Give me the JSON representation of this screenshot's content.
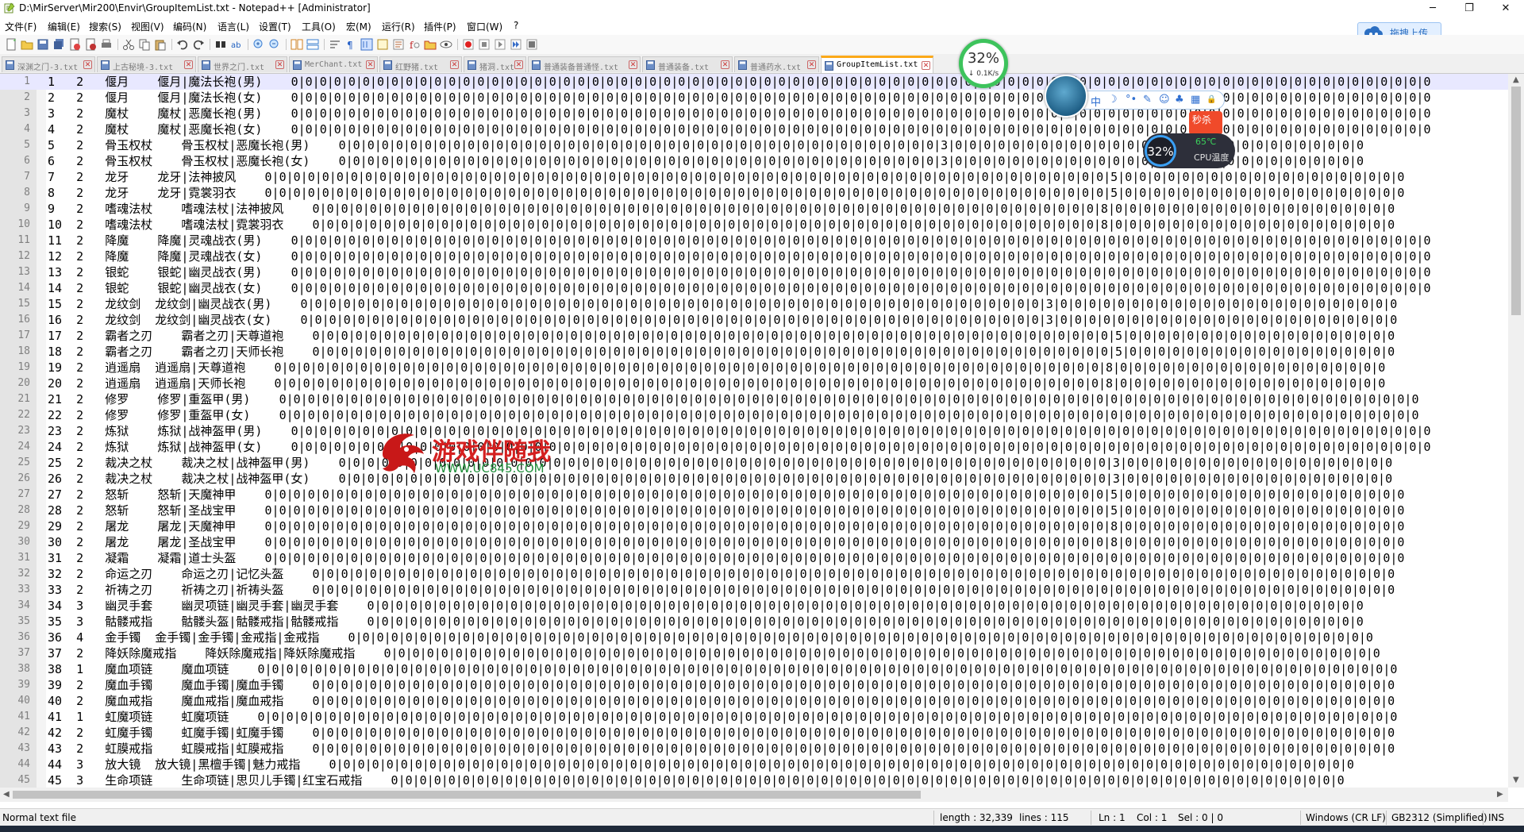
{
  "window": {
    "title": "D:\\MirServer\\Mir200\\Envir\\GroupItemList.txt - Notepad++ [Administrator]",
    "minimize": "─",
    "maximize": "❐",
    "close": "✕"
  },
  "menu": [
    {
      "label": "文件(F)"
    },
    {
      "label": "编辑(E)"
    },
    {
      "label": "搜索(S)"
    },
    {
      "label": "视图(V)"
    },
    {
      "label": "编码(N)"
    },
    {
      "label": "语言(L)"
    },
    {
      "label": "设置(T)"
    },
    {
      "label": "工具(O)"
    },
    {
      "label": "宏(M)"
    },
    {
      "label": "运行(R)"
    },
    {
      "label": "插件(P)"
    },
    {
      "label": "窗口(W)"
    },
    {
      "label": "?"
    }
  ],
  "upload_button": {
    "label": "拖拽上传"
  },
  "tabs": [
    {
      "label": "深渊之门-3.txt",
      "active": false
    },
    {
      "label": "上古秘境-3.txt",
      "active": false
    },
    {
      "label": "世界之门.txt",
      "active": false
    },
    {
      "label": "MerChant.txt",
      "active": false
    },
    {
      "label": "红野猪.txt",
      "active": false
    },
    {
      "label": "猪洞.txt",
      "active": false
    },
    {
      "label": "普通装备普通怪.txt",
      "active": false
    },
    {
      "label": "普通装备.txt",
      "active": false
    },
    {
      "label": "普通药水.txt",
      "active": false
    },
    {
      "label": "GroupItemList.txt",
      "active": true
    }
  ],
  "editor": {
    "current_line": 1,
    "lines": [
      {
        "n": "1",
        "text": "1   2   偃月    偃月|魔法长袍(男)    0|0|0|0|0|0|0|0|0|0|0|0|0|0|0|0|0|0|0|0|0|0|0|0|0|0|0|0|0|0|0|0|0|0|0|0|0|0|0|0|0|0|0|0|0|0|0|0|0|0|0|0|0|0|0|0|0|0|0|0|0|0|0|0|0|0|0|0|0|0|0|0|0|0|0|0|0|0|0|0"
      },
      {
        "n": "2",
        "text": "2   2   偃月    偃月|魔法长袍(女)    0|0|0|0|0|0|0|0|0|0|0|0|0|0|0|0|0|0|0|0|0|0|0|0|0|0|0|0|0|0|0|0|0|0|0|0|0|0|0|0|0|0|0|0|0|0|0|0|0|0|0|0|0|0|0|0|0|0|0|0|0|0|0|0|0|0|0|0|0|0|0|0|0|0|0|0|0|0|0|0"
      },
      {
        "n": "3",
        "text": "3   2   魔杖    魔杖|恶魔长袍(男)    0|0|0|0|0|0|0|0|0|0|0|0|0|0|0|0|0|0|0|0|0|0|0|0|0|0|0|0|0|0|0|0|0|0|0|0|0|0|0|0|0|0|0|0|0|0|0|0|0|0|0|0|0|0|0|0|0|0|0|0|0|0|0|0|0|0|0|0|0|0|0|0|0|0|0|0|0|0|0|0"
      },
      {
        "n": "4",
        "text": "4   2   魔杖    魔杖|恶魔长袍(女)    0|0|0|0|0|0|0|0|0|0|0|0|0|0|0|0|0|0|0|0|0|0|0|0|0|0|0|0|0|0|0|0|0|0|0|0|0|0|0|0|0|0|0|0|0|0|0|0|0|0|0|0|0|0|0|0|0|0|0|0|0|0|0|0|0|0|0|0|0|0|0|0|0|0|0|0|0|0|0|0"
      },
      {
        "n": "5",
        "text": "5   2   骨玉权杖    骨玉权杖|恶魔长袍(男)    0|0|0|0|0|0|0|0|0|0|0|0|0|0|0|0|0|0|0|0|0|0|0|0|0|0|0|0|0|0|0|0|0|0|0|0|0|0|0|0|0|0|3|0|0|0|0|0|0|0|0|0|0|0|0|0|0|0|0|0|0|0|0|0|0|0|0|0|0|0|0|0"
      },
      {
        "n": "6",
        "text": "6   2   骨玉权杖    骨玉权杖|恶魔长袍(女)    0|0|0|0|0|0|0|0|0|0|0|0|0|0|0|0|0|0|0|0|0|0|0|0|0|0|0|0|0|0|0|0|0|0|0|0|0|0|0|0|0|0|3|0|0|0|0|0|0|0|0|0|0|0|0|0|0|0|0|0|0|0|0|0|0|0|0|0|0|0|0|0"
      },
      {
        "n": "7",
        "text": "7   2   龙牙    龙牙|法神披风    0|0|0|0|0|0|0|0|0|0|0|0|0|0|0|0|0|0|0|0|0|0|0|0|0|0|0|0|0|0|0|0|0|0|0|0|0|0|0|0|0|0|0|0|0|0|0|0|0|0|0|0|0|0|0|0|0|0|0|5|0|0|0|0|0|0|0|0|0|0|0|0|0|0|0|0|0|0|0|0"
      },
      {
        "n": "8",
        "text": "8   2   龙牙    龙牙|霓裳羽衣    0|0|0|0|0|0|0|0|0|0|0|0|0|0|0|0|0|0|0|0|0|0|0|0|0|0|0|0|0|0|0|0|0|0|0|0|0|0|0|0|0|0|0|0|0|0|0|0|0|0|0|0|0|0|0|0|0|0|0|5|0|0|0|0|0|0|0|0|0|0|0|0|0|0|0|0|0|0|0|0"
      },
      {
        "n": "9",
        "text": "9   2   嗜魂法杖    嗜魂法杖|法神披风    0|0|0|0|0|0|0|0|0|0|0|0|0|0|0|0|0|0|0|0|0|0|0|0|0|0|0|0|0|0|0|0|0|0|0|0|0|0|0|0|0|0|0|0|0|0|0|0|0|0|0|0|0|0|0|8|0|0|0|0|0|0|0|0|0|0|0|0|0|0|0|0|0|0|0|0"
      },
      {
        "n": "10",
        "text": "10  2   嗜魂法杖    嗜魂法杖|霓裳羽衣    0|0|0|0|0|0|0|0|0|0|0|0|0|0|0|0|0|0|0|0|0|0|0|0|0|0|0|0|0|0|0|0|0|0|0|0|0|0|0|0|0|0|0|0|0|0|0|0|0|0|0|0|0|0|0|8|0|0|0|0|0|0|0|0|0|0|0|0|0|0|0|0|0|0|0|0"
      },
      {
        "n": "11",
        "text": "11  2   降魔    降魔|灵魂战衣(男)    0|0|0|0|0|0|0|0|0|0|0|0|0|0|0|0|0|0|0|0|0|0|0|0|0|0|0|0|0|0|0|0|0|0|0|0|0|0|0|0|0|0|0|0|0|0|0|0|0|0|0|0|0|0|0|0|0|0|0|0|0|0|0|0|0|0|0|0|0|0|0|0|0|0|0|0|0|0|0|0"
      },
      {
        "n": "12",
        "text": "12  2   降魔    降魔|灵魂战衣(女)    0|0|0|0|0|0|0|0|0|0|0|0|0|0|0|0|0|0|0|0|0|0|0|0|0|0|0|0|0|0|0|0|0|0|0|0|0|0|0|0|0|0|0|0|0|0|0|0|0|0|0|0|0|0|0|0|0|0|0|0|0|0|0|0|0|0|0|0|0|0|0|0|0|0|0|0|0|0|0|0"
      },
      {
        "n": "13",
        "text": "13  2   银蛇    银蛇|幽灵战衣(男)    0|0|0|0|0|0|0|0|0|0|0|0|0|0|0|0|0|0|0|0|0|0|0|0|0|0|0|0|0|0|0|0|0|0|0|0|0|0|0|0|0|0|0|0|0|0|0|0|0|0|0|0|0|0|0|0|0|0|0|0|0|0|0|0|0|0|0|0|0|0|0|0|0|0|0|0|0|0|0|0"
      },
      {
        "n": "14",
        "text": "14  2   银蛇    银蛇|幽灵战衣(女)    0|0|0|0|0|0|0|0|0|0|0|0|0|0|0|0|0|0|0|0|0|0|0|0|0|0|0|0|0|0|0|0|0|0|0|0|0|0|0|0|0|0|0|0|0|0|0|0|0|0|0|0|0|0|0|0|0|0|0|0|0|0|0|0|0|0|0|0|0|0|0|0|0|0|0|0|0|0|0|0"
      },
      {
        "n": "15",
        "text": "15  2   龙纹剑  龙纹剑|幽灵战衣(男)    0|0|0|0|0|0|0|0|0|0|0|0|0|0|0|0|0|0|0|0|0|0|0|0|0|0|0|0|0|0|0|0|0|0|0|0|0|0|0|0|0|0|0|0|0|0|0|0|0|0|0|0|3|0|0|0|0|0|0|0|0|0|0|0|0|0|0|0|0|0|0|0|0|0|0|0|0"
      },
      {
        "n": "16",
        "text": "16  2   龙纹剑  龙纹剑|幽灵战衣(女)    0|0|0|0|0|0|0|0|0|0|0|0|0|0|0|0|0|0|0|0|0|0|0|0|0|0|0|0|0|0|0|0|0|0|0|0|0|0|0|0|0|0|0|0|0|0|0|0|0|0|0|0|3|0|0|0|0|0|0|0|0|0|0|0|0|0|0|0|0|0|0|0|0|0|0|0|0"
      },
      {
        "n": "17",
        "text": "17  2   霸者之刃    霸者之刃|天尊道袍    0|0|0|0|0|0|0|0|0|0|0|0|0|0|0|0|0|0|0|0|0|0|0|0|0|0|0|0|0|0|0|0|0|0|0|0|0|0|0|0|0|0|0|0|0|0|0|0|0|0|0|0|0|0|0|0|5|0|0|0|0|0|0|0|0|0|0|0|0|0|0|0|0|0|0|0"
      },
      {
        "n": "18",
        "text": "18  2   霸者之刃    霸者之刃|天师长袍    0|0|0|0|0|0|0|0|0|0|0|0|0|0|0|0|0|0|0|0|0|0|0|0|0|0|0|0|0|0|0|0|0|0|0|0|0|0|0|0|0|0|0|0|0|0|0|0|0|0|0|0|0|0|0|0|5|0|0|0|0|0|0|0|0|0|0|0|0|0|0|0|0|0|0|0"
      },
      {
        "n": "19",
        "text": "19  2   逍遥扇  逍遥扇|天尊道袍    0|0|0|0|0|0|0|0|0|0|0|0|0|0|0|0|0|0|0|0|0|0|0|0|0|0|0|0|0|0|0|0|0|0|0|0|0|0|0|0|0|0|0|0|0|0|0|0|0|0|0|0|0|0|0|0|0|0|8|0|0|0|0|0|0|0|0|0|0|0|0|0|0|0|0|0|0|0"
      },
      {
        "n": "20",
        "text": "20  2   逍遥扇  逍遥扇|天师长袍    0|0|0|0|0|0|0|0|0|0|0|0|0|0|0|0|0|0|0|0|0|0|0|0|0|0|0|0|0|0|0|0|0|0|0|0|0|0|0|0|0|0|0|0|0|0|0|0|0|0|0|0|0|0|0|0|0|0|8|0|0|0|0|0|0|0|0|0|0|0|0|0|0|0|0|0|0|0"
      },
      {
        "n": "21",
        "text": "21  2   修罗    修罗|重盔甲(男)    0|0|0|0|0|0|0|0|0|0|0|0|0|0|0|0|0|0|0|0|0|0|0|0|0|0|0|0|0|0|0|0|0|0|0|0|0|0|0|0|0|0|0|0|0|0|0|0|0|0|0|0|0|0|0|0|0|0|0|0|0|0|0|0|0|0|0|0|0|0|0|0|0|0|0|0|0|0|0|0"
      },
      {
        "n": "22",
        "text": "22  2   修罗    修罗|重盔甲(女)    0|0|0|0|0|0|0|0|0|0|0|0|0|0|0|0|0|0|0|0|0|0|0|0|0|0|0|0|0|0|0|0|0|0|0|0|0|0|0|0|0|0|0|0|0|0|0|0|0|0|0|0|0|0|0|0|0|0|0|0|0|0|0|0|0|0|0|0|0|0|0|0|0|0|0|0|0|0|0|0"
      },
      {
        "n": "23",
        "text": "23  2   炼狱    炼狱|战神盔甲(男)    0|0|0|0|0|0|0|0|0|0|0|0|0|0|0|0|0|0|0|0|0|0|0|0|0|0|0|0|0|0|0|0|0|0|0|0|0|0|0|0|0|0|0|0|0|0|0|0|0|0|0|0|0|0|0|0|0|0|0|0|0|0|0|0|0|0|0|0|0|0|0|0|0|0|0|0|0|0|0|0"
      },
      {
        "n": "24",
        "text": "24  2   炼狱    炼狱|战神盔甲(女)    0|0|0|0|0|0|0|0|0|0|0|0|0|0|0|0|0|0|0|0|0|0|0|0|0|0|0|0|0|0|0|0|0|0|0|0|0|0|0|0|0|0|0|0|0|0|0|0|0|0|0|0|0|0|0|0|0|0|0|0|0|0|0|0|0|0|0|0|0|0|0|0|0|0|0|0|0|0|0|0"
      },
      {
        "n": "25",
        "text": "25  2   裁决之杖    裁决之杖|战神盔甲(男)    0|0|0|0|0|0|0|0|0|0|0|0|0|0|0|0|0|0|0|0|0|0|0|0|0|0|0|0|0|0|0|0|0|0|0|0|0|0|0|0|0|0|0|0|0|0|0|0|0|0|0|0|0|0|3|0|0|0|0|0|0|0|0|0|0|0|0|0|0|0|0|0|0|0"
      },
      {
        "n": "26",
        "text": "26  2   裁决之杖    裁决之杖|战神盔甲(女)    0|0|0|0|0|0|0|0|0|0|0|0|0|0|0|0|0|0|0|0|0|0|0|0|0|0|0|0|0|0|0|0|0|0|0|0|0|0|0|0|0|0|0|0|0|0|0|0|0|0|0|0|0|0|3|0|0|0|0|0|0|0|0|0|0|0|0|0|0|0|0|0|0|0"
      },
      {
        "n": "27",
        "text": "27  2   怒斩    怒斩|天魔神甲    0|0|0|0|0|0|0|0|0|0|0|0|0|0|0|0|0|0|0|0|0|0|0|0|0|0|0|0|0|0|0|0|0|0|0|0|0|0|0|0|0|0|0|0|0|0|0|0|0|0|0|0|0|0|0|0|0|0|0|5|0|0|0|0|0|0|0|0|0|0|0|0|0|0|0|0|0|0|0|0"
      },
      {
        "n": "28",
        "text": "28  2   怒斩    怒斩|圣战宝甲    0|0|0|0|0|0|0|0|0|0|0|0|0|0|0|0|0|0|0|0|0|0|0|0|0|0|0|0|0|0|0|0|0|0|0|0|0|0|0|0|0|0|0|0|0|0|0|0|0|0|0|0|0|0|0|0|0|0|0|5|0|0|0|0|0|0|0|0|0|0|0|0|0|0|0|0|0|0|0|0"
      },
      {
        "n": "29",
        "text": "29  2   屠龙    屠龙|天魔神甲    0|0|0|0|0|0|0|0|0|0|0|0|0|0|0|0|0|0|0|0|0|0|0|0|0|0|0|0|0|0|0|0|0|0|0|0|0|0|0|0|0|0|0|0|0|0|0|0|0|0|0|0|0|0|0|0|0|0|0|8|0|0|0|0|0|0|0|0|0|0|0|0|0|0|0|0|0|0|0|0"
      },
      {
        "n": "30",
        "text": "30  2   屠龙    屠龙|圣战宝甲    0|0|0|0|0|0|0|0|0|0|0|0|0|0|0|0|0|0|0|0|0|0|0|0|0|0|0|0|0|0|0|0|0|0|0|0|0|0|0|0|0|0|0|0|0|0|0|0|0|0|0|0|0|0|0|0|0|0|0|8|0|0|0|0|0|0|0|0|0|0|0|0|0|0|0|0|0|0|0|0"
      },
      {
        "n": "31",
        "text": "31  2   凝霜    凝霜|道士头盔    0|0|0|0|0|0|0|0|0|0|0|0|0|0|0|0|0|0|0|0|0|0|0|0|0|0|0|0|0|0|0|0|0|0|0|0|0|0|0|0|0|0|0|0|0|0|0|0|0|0|0|0|0|0|0|0|0|0|0|0|0|0|0|0|0|0|0|0|0|0|0|0|0|0|0|0|0|0|0|0"
      },
      {
        "n": "32",
        "text": "32  2   命运之刃    命运之刃|记忆头盔    0|0|0|0|0|0|0|0|0|0|0|0|0|0|0|0|0|0|0|0|0|0|0|0|0|0|0|0|0|0|0|0|0|0|0|0|0|0|0|0|0|0|0|0|0|0|0|0|0|0|0|0|0|0|0|0|0|0|0|0|0|0|0|0|0|0|0|0|0|0|0|0|0|0|0|0"
      },
      {
        "n": "33",
        "text": "33  2   祈祷之刃    祈祷之刃|祈祷头盔    0|0|0|0|0|0|0|0|0|0|0|0|0|0|0|0|0|0|0|0|0|0|0|0|0|0|0|0|0|0|0|0|0|0|0|0|0|0|0|0|0|0|0|0|0|0|0|0|0|0|0|0|0|0|0|0|0|0|0|0|0|0|0|0|0|0|0|0|0|0|0|0|0|0|0|0"
      },
      {
        "n": "34",
        "text": "34  3   幽灵手套    幽灵项链|幽灵手套|幽灵手套    0|0|0|0|0|0|0|0|0|0|0|0|0|0|0|0|0|0|0|0|0|0|0|0|0|0|0|0|0|0|0|0|0|0|0|0|0|0|0|0|0|0|0|0|0|0|0|0|0|0|0|0|0|0|0|0|0|0|0|0|0|0|0|0|0|0|0|0|0|0"
      },
      {
        "n": "35",
        "text": "35  3   骷髅戒指    骷髅头盔|骷髅戒指|骷髅戒指    0|0|0|0|0|0|0|0|0|0|0|0|0|0|0|0|0|0|0|0|0|0|0|0|0|0|0|0|0|0|0|0|0|0|0|0|0|0|0|0|0|0|0|0|0|0|0|0|0|0|0|0|0|0|0|0|0|0|0|0|0|0|0|0|0|0|0|0|0|0"
      },
      {
        "n": "36",
        "text": "36  4   金手镯  金手镯|金手镯|金戒指|金戒指    0|0|0|0|0|0|0|0|0|0|0|0|0|0|0|0|0|0|0|0|0|0|0|0|0|0|0|0|0|0|0|0|0|0|0|0|0|0|0|0|0|0|0|0|0|0|0|0|0|0|0|0|0|0|0|0|0|0|0|0|0|0|0|0|0|0|0|0|0|0|0|0"
      },
      {
        "n": "37",
        "text": "37  2   降妖除魔戒指    降妖除魔戒指|降妖除魔戒指    0|0|0|0|0|0|0|0|0|0|0|0|0|0|0|0|0|0|0|0|0|0|0|0|0|0|0|0|0|0|0|0|0|0|0|0|0|0|0|0|0|0|0|0|0|0|0|0|0|0|0|0|0|0|0|0|0|0|0|0|0|0|0|0|0|0|0|0|0|0"
      },
      {
        "n": "38",
        "text": "38  1   魔血项链    魔血项链    0|0|0|0|0|0|0|0|0|0|0|0|0|0|0|0|0|0|0|0|0|0|0|0|0|0|0|0|0|0|0|0|0|0|0|0|0|0|0|0|0|0|0|0|0|0|0|0|0|0|0|0|0|0|0|0|0|0|0|0|0|0|0|0|0|0|0|0|0|0|0|0|0|0|0|0|0|0|0|0"
      },
      {
        "n": "39",
        "text": "39  2   魔血手镯    魔血手镯|魔血手镯    0|0|0|0|0|0|0|0|0|0|0|0|0|0|0|0|0|0|0|0|0|0|0|0|0|0|0|0|0|0|0|0|0|0|0|0|0|0|0|0|0|0|0|0|0|0|0|0|0|0|0|0|0|0|0|0|0|0|0|0|0|0|0|0|0|0|0|0|0|0|0|0|0|0|0|0"
      },
      {
        "n": "40",
        "text": "40  2   魔血戒指    魔血戒指|魔血戒指    0|0|0|0|0|0|0|0|0|0|0|0|0|0|0|0|0|0|0|0|0|0|0|0|0|0|0|0|0|0|0|0|0|0|0|0|0|0|0|0|0|0|0|0|0|0|0|0|0|0|0|0|0|0|0|0|0|0|0|0|0|0|0|0|0|0|0|0|0|0|0|0|0|0|0|0"
      },
      {
        "n": "41",
        "text": "41  1   虹魔项链    虹魔项链    0|0|0|0|0|0|0|0|0|0|0|0|0|0|0|0|0|0|0|0|0|0|0|0|0|0|0|0|0|0|0|0|0|0|0|0|0|0|0|0|0|0|0|0|0|0|0|0|0|0|0|0|0|0|0|0|0|0|0|0|0|0|0|0|0|0|0|0|0|0|0|0|0|0|0|0|0|0|0|0"
      },
      {
        "n": "42",
        "text": "42  2   虹魔手镯    虹魔手镯|虹魔手镯    0|0|0|0|0|0|0|0|0|0|0|0|0|0|0|0|0|0|0|0|0|0|0|0|0|0|0|0|0|0|0|0|0|0|0|0|0|0|0|0|0|0|0|0|0|0|0|0|0|0|0|0|0|0|0|0|0|0|0|0|0|0|0|0|0|0|0|0|0|0|0|0|0|0|0|0"
      },
      {
        "n": "43",
        "text": "43  2   虹膜戒指    虹膜戒指|虹膜戒指    0|0|0|0|0|0|0|0|0|0|0|0|0|0|0|0|0|0|0|0|0|0|0|0|0|0|0|0|0|0|0|0|0|0|0|0|0|0|0|0|0|0|0|0|0|0|0|0|0|0|0|0|0|0|0|0|0|0|0|0|0|0|0|0|0|0|0|0|0|0|0|0|0|0|0|0"
      },
      {
        "n": "44",
        "text": "44  3   放大镜  放大镜|黑檀手镯|魅力戒指    0|0|0|0|0|0|0|0|0|0|0|0|0|0|0|0|0|0|0|0|0|0|0|0|0|0|0|0|0|0|0|0|0|0|0|0|0|0|0|0|0|0|0|0|0|0|0|0|0|0|0|0|0|0|0|0|0|0|0|0|0|0|0|0|0|0|0|0|0|0|0|0"
      },
      {
        "n": "45",
        "text": "45  3   生命项链    生命项链|思贝儿手镯|红宝石戒指    0|0|0|0|0|0|0|0|0|0|0|0|0|0|0|0|0|0|0|0|0|0|0|0|0|0|0|0|0|0|0|0|0|0|0|0|0|0|0|0|0|0|0|0|0|0|0|0|0|0|0|0|0|0|0|0|0|0|0|0|0|0|0|0|0|0|0"
      }
    ]
  },
  "status": {
    "file_type": "Normal text file",
    "length": "length : 32,339",
    "lines": "lines : 115",
    "ln": "Ln : 1",
    "col": "Col : 1",
    "sel": "Sel : 0 | 0",
    "eol": "Windows (CR LF)",
    "encoding": "GB2312 (Simplified)",
    "mode": "INS"
  },
  "network_widget": {
    "percent": "32%",
    "speed": "↓ 0.1K/s"
  },
  "ime_toolbar": {
    "lang": "中",
    "moon": "☽",
    "punct": "°•",
    "wrench": "✎",
    "smile": "☺",
    "shirt": "♣",
    "grid": "▦",
    "lock": "🔒"
  },
  "cpu_widget": {
    "percent": "32%",
    "temp": "65℃",
    "label": "CPU温度"
  },
  "seckill_badge": {
    "label": "秒杀"
  },
  "watermark": {
    "title": "游戏伴随我",
    "url": "WWW.UC845.COM"
  },
  "colors": {
    "accent_tab": "#fba919",
    "selection_line": "#e8e8ff",
    "gutter": "#e4e4e4"
  }
}
